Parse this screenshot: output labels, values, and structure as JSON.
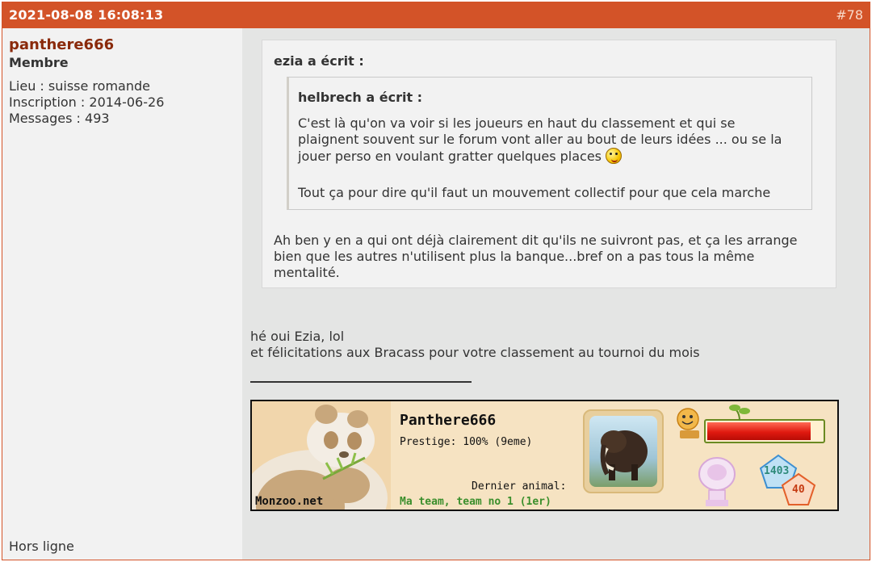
{
  "post": {
    "date": "2021-08-08 16:08:13",
    "number": "#78"
  },
  "author": {
    "username": "panthere666",
    "role": "Membre",
    "location": "Lieu : suisse romande",
    "registered": "Inscription : 2014-06-26",
    "messages": "Messages : 493",
    "status": "Hors ligne"
  },
  "quote": {
    "author": "ezia a écrit :",
    "nested": {
      "author": "helbrech a écrit :",
      "line1": "C'est là qu'on va voir si les joueurs en haut du classement et qui se",
      "line2": "plaignent souvent sur le forum vont aller au bout de leurs idées ... ou se la",
      "line3": "jouer perso en voulant gratter quelques places",
      "line4": "Tout ça pour dire qu'il faut un mouvement collectif pour que cela marche"
    },
    "line1": "Ah ben y en a qui ont déjà clairement dit qu'ils ne suivront pas, et ça les arrange",
    "line2": "bien que les autres n'utilisent plus la banque...bref on a pas tous la même",
    "line3": "mentalité."
  },
  "reply": {
    "line1": "hé oui Ezia,  lol",
    "line2": "et félicitations aux Bracass pour votre classement au tournoi du mois"
  },
  "signature": {
    "site": "Monzoo.net",
    "player": "Panthere666",
    "prestige": "Prestige: 100% (9eme)",
    "last_animal_label": "Dernier animal:",
    "team": "Ma team, team no 1 (1er)",
    "stat_a": "1403",
    "stat_b": "40",
    "health_level": 0.9
  },
  "colors": {
    "header": "#d35328",
    "username": "#8a2a0b",
    "team": "#3b8f2c"
  }
}
